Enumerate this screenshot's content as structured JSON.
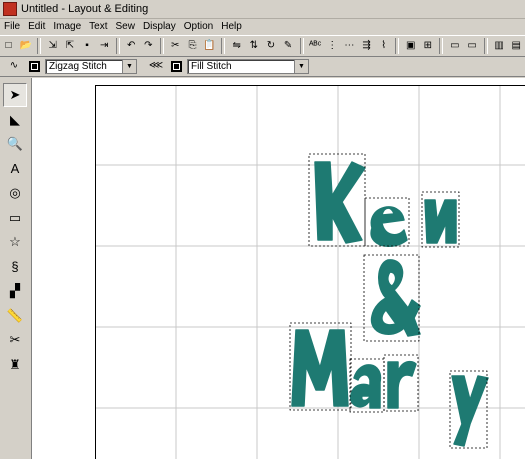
{
  "window": {
    "title": "Untitled - Layout & Editing"
  },
  "menu": [
    "File",
    "Edit",
    "Image",
    "Text",
    "Sew",
    "Display",
    "Option",
    "Help"
  ],
  "toolbar1": {
    "buttons": [
      {
        "name": "new",
        "icon": "new-file-icon",
        "glyph": "□"
      },
      {
        "name": "open",
        "icon": "open-folder-icon",
        "glyph": "📂"
      },
      {
        "name": "import",
        "icon": "import-icon",
        "glyph": "⇲"
      },
      {
        "name": "import2",
        "icon": "import-design-icon",
        "glyph": "⇱"
      },
      {
        "name": "save",
        "icon": "save-icon",
        "glyph": "▪"
      },
      {
        "name": "send",
        "icon": "send-to-card-icon",
        "glyph": "⇥"
      },
      {
        "name": "undo",
        "icon": "undo-icon",
        "glyph": "↶"
      },
      {
        "name": "redo",
        "icon": "redo-icon",
        "glyph": "↷"
      },
      {
        "name": "cut",
        "icon": "cut-icon",
        "glyph": "✂"
      },
      {
        "name": "copy",
        "icon": "copy-icon",
        "glyph": "⎘"
      },
      {
        "name": "paste",
        "icon": "paste-icon",
        "glyph": "📋"
      },
      {
        "name": "mirror",
        "icon": "mirror-icon",
        "glyph": "⇋"
      },
      {
        "name": "flip",
        "icon": "flip-icon",
        "glyph": "⇅"
      },
      {
        "name": "rotate",
        "icon": "rotate-icon",
        "glyph": "↻"
      },
      {
        "name": "magic",
        "icon": "magic-wand-icon",
        "glyph": "✎"
      },
      {
        "name": "text-attr",
        "icon": "text-attribute-icon",
        "glyph": "ᴬᴮᶜ"
      },
      {
        "name": "align",
        "icon": "text-align-icon",
        "glyph": "⋮"
      },
      {
        "name": "arrange",
        "icon": "arrange-icon",
        "glyph": "⋯"
      },
      {
        "name": "sew-order",
        "icon": "sewing-order-icon",
        "glyph": "⇶"
      },
      {
        "name": "stitch",
        "icon": "stitch-icon",
        "glyph": "⌇"
      },
      {
        "name": "design-page",
        "icon": "design-page-icon",
        "glyph": "▣"
      },
      {
        "name": "hoop",
        "icon": "hoop-icon",
        "glyph": "⊞"
      },
      {
        "name": "view1",
        "icon": "preview-icon",
        "glyph": "▭"
      },
      {
        "name": "view2",
        "icon": "realistic-preview-icon",
        "glyph": "▭"
      },
      {
        "name": "property",
        "icon": "property-icon",
        "glyph": "▥"
      },
      {
        "name": "help",
        "icon": "help-icon",
        "glyph": "▤"
      }
    ]
  },
  "toolbar2": {
    "line_stitch": "Zigzag Stitch",
    "region_stitch": "Fill Stitch"
  },
  "tools": [
    {
      "name": "select",
      "icon": "select-arrow-icon",
      "glyph": "➤",
      "active": true
    },
    {
      "name": "point-edit",
      "icon": "point-edit-icon",
      "glyph": "◣"
    },
    {
      "name": "zoom",
      "icon": "zoom-icon",
      "glyph": "🔍"
    },
    {
      "name": "text",
      "icon": "text-tool-icon",
      "glyph": "A"
    },
    {
      "name": "circle",
      "icon": "circle-tool-icon",
      "glyph": "◎"
    },
    {
      "name": "rectangle",
      "icon": "rectangle-tool-icon",
      "glyph": "▭"
    },
    {
      "name": "shape",
      "icon": "shape-tool-icon",
      "glyph": "☆"
    },
    {
      "name": "outline",
      "icon": "outline-tool-icon",
      "glyph": "§"
    },
    {
      "name": "stitch-shape",
      "icon": "stitch-shape-icon",
      "glyph": "▞"
    },
    {
      "name": "measure",
      "icon": "measure-icon",
      "glyph": "📏"
    },
    {
      "name": "manual-punch",
      "icon": "manual-punch-icon",
      "glyph": "✂"
    },
    {
      "name": "stamp",
      "icon": "stamp-icon",
      "glyph": "♜"
    }
  ],
  "design": {
    "thread_color": "#1e7a72",
    "letters": [
      "K",
      "e",
      "n",
      "&",
      "M",
      "a",
      "r",
      "y"
    ]
  }
}
